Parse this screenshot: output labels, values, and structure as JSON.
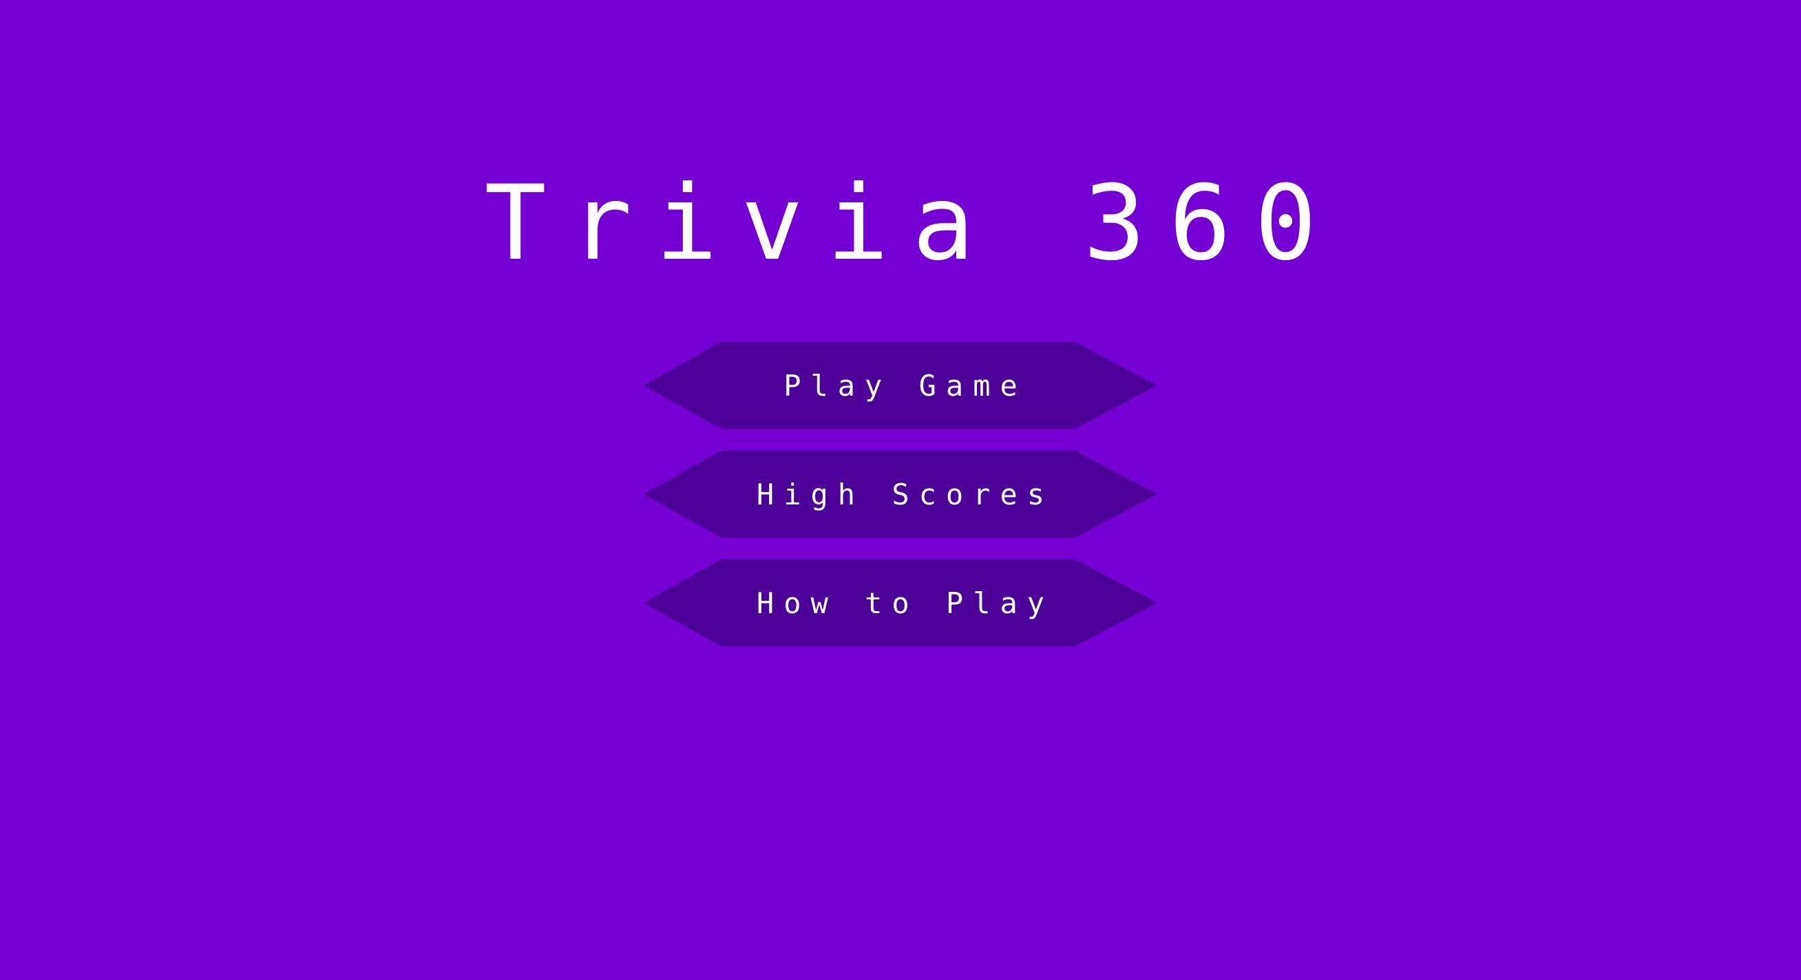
{
  "title": "Trivia 360",
  "menu": {
    "items": [
      {
        "label": "Play Game"
      },
      {
        "label": "High Scores"
      },
      {
        "label": "How to Play"
      }
    ]
  },
  "colors": {
    "background": "#7400d4",
    "button": "#4d0097",
    "text": "#ffffff"
  }
}
